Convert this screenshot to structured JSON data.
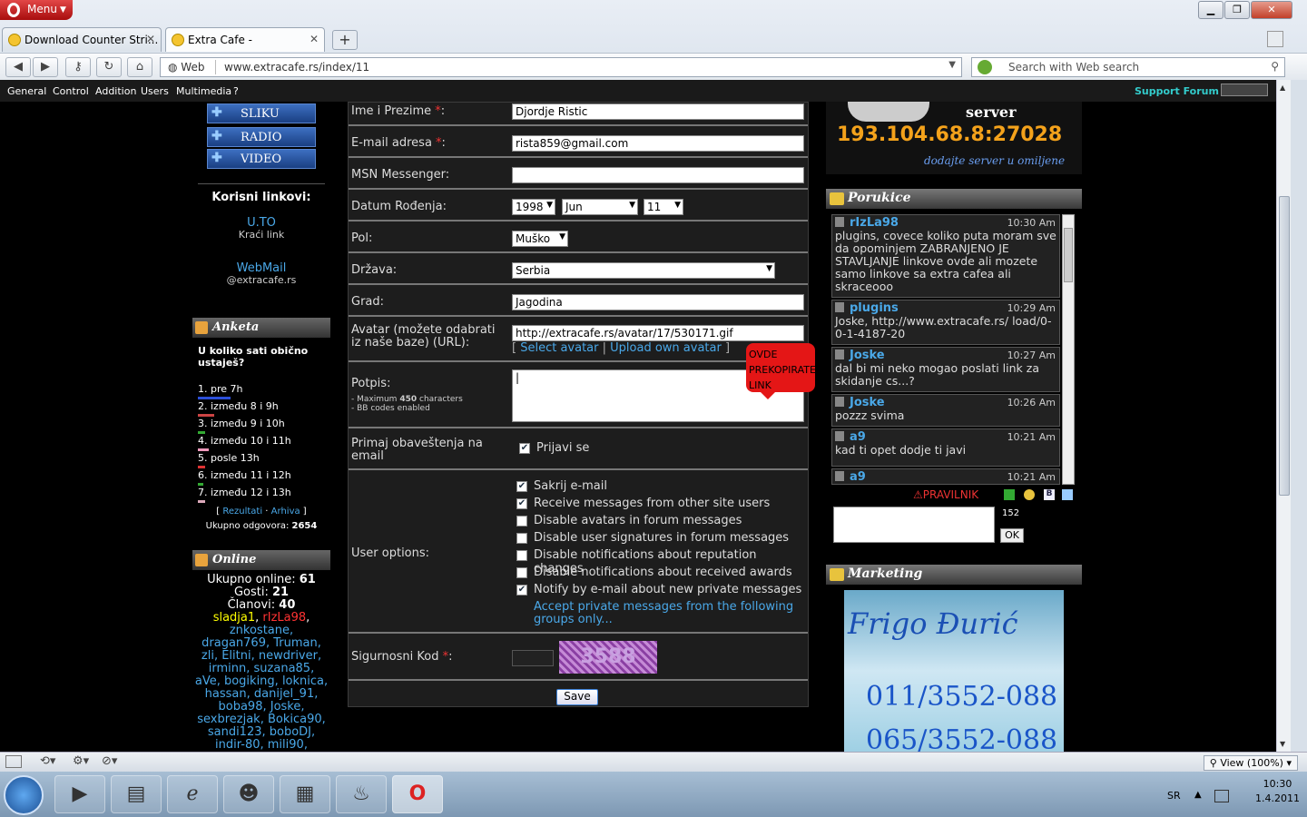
{
  "browser": {
    "menu_label": "Menu",
    "tabs": [
      {
        "label": "Download Counter Stri..."
      },
      {
        "label": "Extra Cafe -"
      }
    ],
    "web_label": "Web",
    "address": "www.extracafe.rs/index/11",
    "search_placeholder": "Search with Web search",
    "bookmarks": [
      "General",
      "Control",
      "Addition",
      "Users",
      "Multimedia",
      "?"
    ],
    "support_forum": "Support Forum",
    "zoom": "View (100%)"
  },
  "left": {
    "buttons": [
      "SLIKU",
      "RADIO",
      "VIDEO"
    ],
    "links_title": "Korisni linkovi:",
    "link1": "U.TO",
    "link1_sub": "Kraći link",
    "link2": "WebMail",
    "link2_sub": "@extracafe.rs",
    "poll": {
      "title": "Anketa",
      "question": "U koliko sati obično ustaješ?",
      "options": [
        {
          "label": "1. pre 7h",
          "color": "#2b4fd9",
          "pct": 0.9
        },
        {
          "label": "2. između 8 i 9h",
          "color": "#c44",
          "pct": 0.45
        },
        {
          "label": "3. između 9 i 10h",
          "color": "#3a3",
          "pct": 0.2
        },
        {
          "label": "4. između 10 i 11h",
          "color": "#e9b",
          "pct": 0.3
        },
        {
          "label": "5. posle 13h",
          "color": "#d33",
          "pct": 0.2
        },
        {
          "label": "6. između 11 i 12h",
          "color": "#3a3",
          "pct": 0.15
        },
        {
          "label": "7. između 12 i 13h",
          "color": "#dab",
          "pct": 0.2
        }
      ],
      "results": "Rezultati",
      "archive": "Arhiva",
      "total_label": "Ukupno odgovora:",
      "total": "2654"
    },
    "online": {
      "title": "Online",
      "total_label": "Ukupno online:",
      "total": "61",
      "guests_label": "Gosti:",
      "guests": "21",
      "members_label": "Članovi:",
      "members": "40",
      "u1": "sladja1",
      "u2": "rIzLa98",
      "users": "znkostane, dragan769, Truman, zli, Elitni, newdriver, irminn, suzana85, aVe, bogiking, loknica, hassan, danijel_91, boba98, Joske, sexbrezjak, Bokica90, sandi123, boboDJ, indir-80, mili90,"
    }
  },
  "form": {
    "name_label": "Ime i Prezime",
    "name_value": "Djordje Ristic",
    "email_label": "E-mail adresa",
    "email_value": "rista859@gmail.com",
    "msn_label": "MSN Messenger:",
    "dob_label": "Datum Rođenja:",
    "dob_year": "1998",
    "dob_month": "Jun",
    "dob_day": "11",
    "gender_label": "Pol:",
    "gender_value": "Muško",
    "country_label": "Država:",
    "country_value": "Serbia",
    "city_label": "Grad:",
    "city_value": "Jagodina",
    "avatar_label": "Avatar (možete odabrati iz naše baze) (URL):",
    "avatar_value": "http://extracafe.rs/avatar/17/530171.gif",
    "select_avatar": "Select avatar",
    "upload_avatar": "Upload own avatar",
    "tip": "OVDE PREKOPIRATE LINK",
    "sig_label": "Potpis:",
    "sig_max_prefix": "- Maximum",
    "sig_max": "450",
    "sig_max_suffix": "characters",
    "sig_bb": "- BB codes enabled",
    "notify_label": "Primaj obaveštenja na email",
    "notify_opt": "Prijavi se",
    "user_options_label": "User options:",
    "options": [
      {
        "label": "Sakrij e-mail",
        "checked": true
      },
      {
        "label": "Receive messages from other site users",
        "checked": true
      },
      {
        "label": "Disable avatars in forum messages",
        "checked": false
      },
      {
        "label": "Disable user signatures in forum messages",
        "checked": false
      },
      {
        "label": "Disable notifications about reputation changes",
        "checked": false
      },
      {
        "label": "Disable notifications about received awards",
        "checked": false
      },
      {
        "label": "Notify by e-mail about new private messages",
        "checked": true
      }
    ],
    "accept_pm": "Accept private messages from the following groups only...",
    "captcha_label": "Sigurnosni Kod",
    "captcha_text": "3588",
    "save": "Save"
  },
  "right": {
    "server_name": "server",
    "server_ip": "193.104.68.8:27028",
    "server_sub": "dodajte server u omiljene",
    "chat_title": "Porukice",
    "messages": [
      {
        "user": "rIzLa98",
        "time": "10:30 Am",
        "text": "plugins, covece koliko puta moram sve da opominjem ZABRANJENO JE STAVLJANJE linkove ovde ali mozete samo linkove sa extra cafea ali skraceooo"
      },
      {
        "user": "plugins",
        "time": "10:29 Am",
        "text": "Joske, http://www.extracafe.rs/ load/0-0-1-4187-20"
      },
      {
        "user": "Joske",
        "time": "10:27 Am",
        "text": "dal bi mi neko mogao poslati link za skidanje cs...?"
      },
      {
        "user": "Joske",
        "time": "10:26 Am",
        "text": "pozzz svima"
      },
      {
        "user": "a9",
        "time": "10:21 Am",
        "text": "kad ti opet dodje ti javi"
      },
      {
        "user": "a9",
        "time": "10:21 Am",
        "text": ""
      }
    ],
    "rules": "PRAVILNIK",
    "char_count": "152",
    "ok": "OK",
    "marketing_title": "Marketing",
    "ad_title": "Frigo Đurić",
    "ad_phone1": "011/3552-088",
    "ad_phone2": "065/3552-088"
  },
  "taskbar": {
    "lang": "SR",
    "time": "10:30",
    "date": "1.4.2011"
  }
}
